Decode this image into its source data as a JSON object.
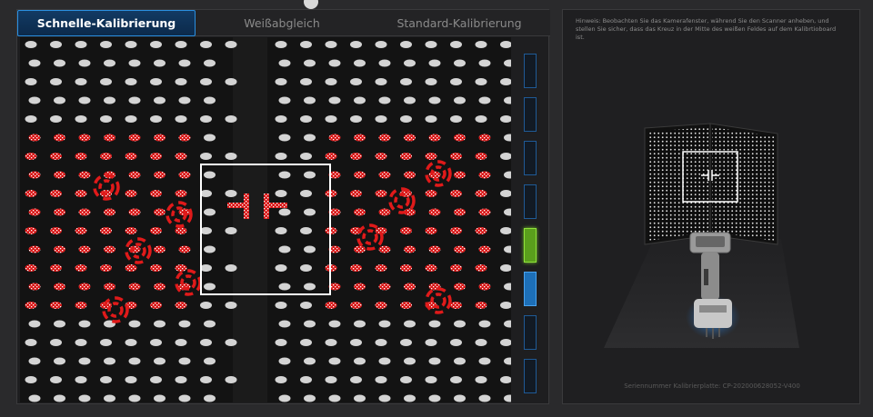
{
  "tabs": [
    {
      "label": "Schnelle-Kalibrierung",
      "active": true
    },
    {
      "label": "Weißabgleich",
      "active": false
    },
    {
      "label": "Standard-Kalibrierung",
      "active": false
    }
  ],
  "indicators": [
    "off",
    "off",
    "off",
    "off",
    "green",
    "blue",
    "off",
    "off"
  ],
  "colors": {
    "accent": "#2a8fe0",
    "active_green": "#76c52a",
    "active_blue": "#1d6fb8",
    "marker_red": "#e01a1a"
  },
  "right_panel": {
    "hint": "Hinweis: Beobachten Sie das Kamerafenster, während Sie den Scanner anheben, und stellen Sie sicher, dass das Kreuz in der Mitte des weißen Feldes auf dem Kalibrtioboard ist.",
    "serial": "Seriennummer Kalibrierplatte: CP-202000628052-V400"
  }
}
